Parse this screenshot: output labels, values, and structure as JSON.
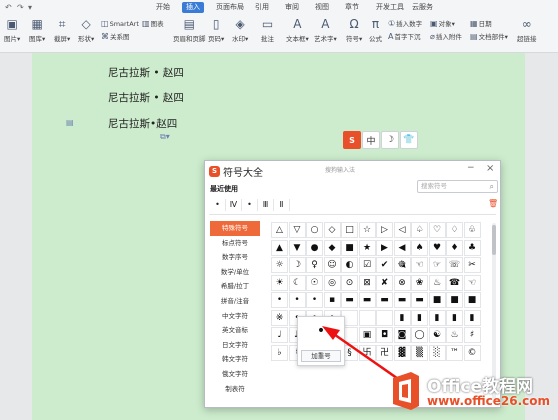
{
  "ribbon": {
    "tabs": [
      "开始",
      "插入",
      "页面布局",
      "引用",
      "审阅",
      "视图",
      "章节",
      "开发工具",
      "云服务"
    ],
    "active_tab": "插入",
    "tools": {
      "picture": "图片",
      "gallery": "图库",
      "screenshot": "截屏",
      "shapes": "形状",
      "smartart": "SmartArt",
      "chart": "图表",
      "relation": "关系图",
      "header_footer": "页眉和页脚",
      "page_number": "页码",
      "watermark": "水印",
      "comment": "批注",
      "textbox": "文本框",
      "wordart": "艺术字",
      "symbol": "符号",
      "formula": "公式",
      "insert_number": "插入数字",
      "object": "对象",
      "date": "日期",
      "first_sink": "首字下沉",
      "attachment": "插入附件",
      "doc_parts": "文档部件",
      "hyperlink": "超链接"
    }
  },
  "document": {
    "lines": [
      "尼古拉斯 • 赵四",
      "尼古拉斯 • 赵四",
      "尼古拉斯•赵四"
    ]
  },
  "ime_toolbar": {
    "logo": "S",
    "mode": "中",
    "moon": "☽",
    "shirt": "👕"
  },
  "dialog": {
    "title": "符号大全",
    "search_hint": "搜狗输入法",
    "recent_label": "最近使用",
    "search_placeholder": "搜索符号",
    "recent_symbols": [
      "•",
      "Ⅳ",
      "•",
      "Ⅲ",
      "Ⅱ"
    ],
    "categories": [
      "特殊符号",
      "标点符号",
      "数字序号",
      "数学/单位",
      "希腊/拉丁",
      "拼音/注音",
      "中文字符",
      "英文音标",
      "日文字符",
      "韩文字符",
      "俄文字符",
      "制表符"
    ],
    "active_category": "特殊符号",
    "grid": [
      [
        "△",
        "▽",
        "○",
        "◇",
        "□",
        "☆",
        "▷",
        "◁",
        "♤",
        "♡",
        "♢",
        "♧"
      ],
      [
        "▲",
        "▼",
        "●",
        "◆",
        "■",
        "★",
        "▶",
        "◀",
        "♠",
        "♥",
        "♦",
        "♣"
      ],
      [
        "☼",
        "☽",
        "♀",
        "☺",
        "◐",
        "☑",
        "✔",
        "🎕",
        "☜",
        "☞",
        "☏",
        "✂"
      ],
      [
        "☀",
        "☾",
        "☉",
        "◎",
        "⊙",
        "⊠",
        "✘",
        "⊗",
        "❀",
        "♨",
        "☎",
        "☜"
      ],
      [
        "•",
        "•",
        "•",
        "▪",
        "▬",
        "▬",
        "▬",
        "▬",
        "▬",
        "■",
        "■",
        "■"
      ],
      [
        "※",
        "•",
        "•",
        "•",
        "",
        "",
        "",
        "▮",
        "▮",
        "▮",
        "▮",
        "▮"
      ],
      [
        "♩",
        "♪",
        "♫",
        "♬",
        "",
        "▣",
        "◘",
        "◙",
        "◯",
        "☯",
        "♨",
        "♯"
      ],
      [
        "♭",
        "♮",
        "♯",
        "¶",
        "§",
        "卐",
        "卍",
        "▓",
        "▒",
        "░",
        "™",
        "©"
      ]
    ],
    "preview_symbol": "•",
    "add_button": "加重号"
  },
  "watermark": {
    "line1": "Office教程网",
    "line2": "www.office26.com"
  },
  "colors": {
    "accent": "#3a7bd5",
    "sogou": "#e8502a",
    "page": "#cdeccd",
    "category_active": "#ef6a3a"
  }
}
